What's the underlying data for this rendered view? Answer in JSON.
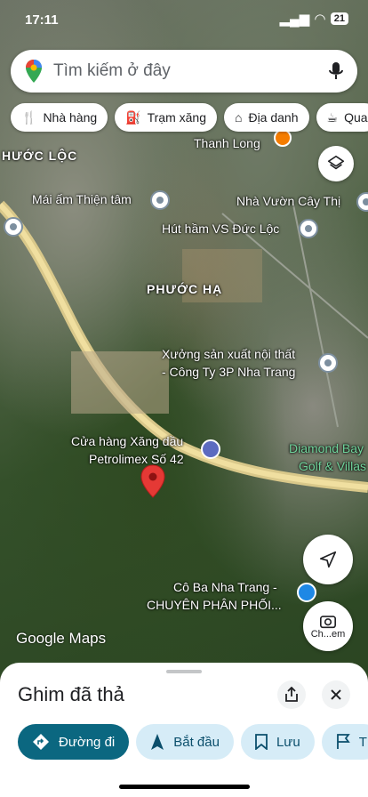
{
  "status": {
    "time": "17:11",
    "battery": "21"
  },
  "search": {
    "placeholder": "Tìm kiếm ở đây"
  },
  "chips": [
    {
      "label": "Nhà hàng",
      "icon": "restaurant-icon"
    },
    {
      "label": "Trạm xăng",
      "icon": "gas-station-icon"
    },
    {
      "label": "Địa danh",
      "icon": "landmark-icon"
    },
    {
      "label": "Qua",
      "icon": "coffee-icon"
    }
  ],
  "map_labels": {
    "phuoc_loc": "HƯỚC LỘC",
    "thanh_long": "Thanh Long",
    "mai_am": "Mái ấm Thiện tâm",
    "nha_vuon": "Nhà Vườn Cây Thị",
    "hut_ham": "Hút hầm VS Đức Lộc",
    "phuoc_ha": "PHƯỚC HẠ",
    "xuong_line1": "Xưởng sản xuất nội thất",
    "xuong_line2": "- Công Ty 3P Nha Trang",
    "diamond_line1": "Diamond Bay",
    "diamond_line2": "Golf & Villas",
    "petro_line1": "Cửa hàng Xăng dầu",
    "petro_line2": "Petrolimex Số 42",
    "coba_line1": "Cô Ba Nha Trang -",
    "coba_line2": "CHUYÊN PHÂN PHỐI...",
    "ch_em": "Ch...em",
    "google_maps": "Google Maps"
  },
  "sheet": {
    "title": "Ghim đã thả",
    "actions": [
      {
        "label": "Đường đi",
        "icon": "directions-icon"
      },
      {
        "label": "Bắt đầu",
        "icon": "navigation-icon"
      },
      {
        "label": "Lưu",
        "icon": "bookmark-icon"
      },
      {
        "label": "T",
        "icon": "flag-icon"
      }
    ]
  },
  "colors": {
    "accent": "#0b6780",
    "pin": "#e53935",
    "action_bg": "#d6ecf7"
  }
}
